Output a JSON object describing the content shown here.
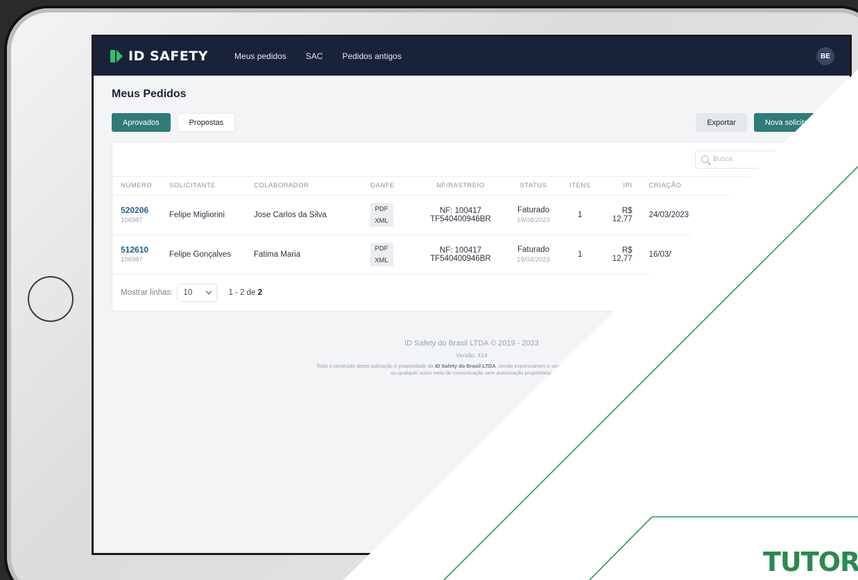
{
  "brand": {
    "name": "ID SAFETY"
  },
  "nav": {
    "links": [
      "Meus pedidos",
      "SAC",
      "Pedidos antigos"
    ],
    "user_initials": "BE"
  },
  "page": {
    "title": "Meus Pedidos",
    "tab_aprovados": "Aprovados",
    "tab_propostas": "Propostas",
    "export_label": "Exportar",
    "new_request_label": "Nova solicitação",
    "search_placeholder": "Busca"
  },
  "table": {
    "headers": [
      "NÚMERO",
      "SOLICITANTE",
      "COLABORADOR",
      "DANFE",
      "NF/RASTREIO",
      "STATUS",
      "ITENS",
      "IPI",
      "CRIAÇÃO"
    ],
    "rows": [
      {
        "numero": "520206",
        "sub": "106987",
        "solicitante": "Felipe Migliorini",
        "colaborador": "Jose Carlos da Silva",
        "danfe": [
          "PDF",
          "XML"
        ],
        "nf": "NF: 100417",
        "rastreio": "TF540400946BR",
        "status": "Faturado",
        "status_date": "19/04/2023",
        "itens": "1",
        "ipi": "R$ 12,77",
        "criacao": "24/03/2023"
      },
      {
        "numero": "512610",
        "sub": "106987",
        "solicitante": "Felipe Gonçalves",
        "colaborador": "Fatima Maria",
        "danfe": [
          "PDF",
          "XML"
        ],
        "nf": "NF: 100417",
        "rastreio": "TF540400946BR",
        "status": "Faturado",
        "status_date": "19/04/2023",
        "itens": "1",
        "ipi": "R$ 12,77",
        "criacao": "16/03/"
      }
    ]
  },
  "pager": {
    "label": "Mostrar linhas:",
    "rows_value": "10",
    "range_start": "1 - 2",
    "range_of": "de",
    "range_total": "2"
  },
  "footer": {
    "company": "ID Safety do Brasil LTDA © 2019 - 2023",
    "version": "Versão: 414",
    "legal_pre": "Todo o conteúdo desta aplicação é propriedade da",
    "legal_company": "ID Safety do Brasil LTDA",
    "legal_post": ", sendo expressamen o seu uso em sites, vídeos, cursos ou qualquer outro meio de comunicação sem autorização proprietário."
  },
  "watermark": {
    "text": "TUTOR"
  },
  "colors": {
    "nav_bg": "#1a2238",
    "accent": "#2f7b78",
    "link": "#1f5f92",
    "overlay_line": "#2a9a5a"
  }
}
